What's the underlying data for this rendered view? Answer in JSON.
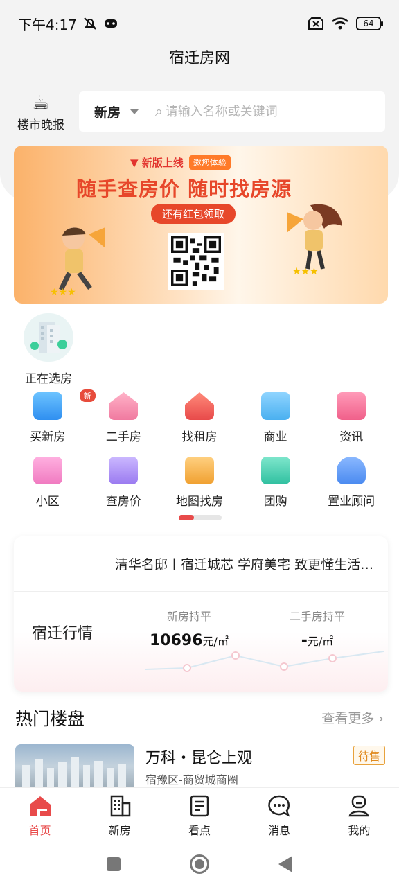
{
  "status_bar": {
    "time": "下午4:17",
    "battery": "64"
  },
  "header": {
    "title": "宿迁房网"
  },
  "evening_report": {
    "label": "楼市晚报",
    "icon": "coffee-cup-icon"
  },
  "search": {
    "type_selected": "新房",
    "placeholder": "请输入名称或关键词"
  },
  "banner": {
    "tag_new": "新版上线",
    "tag_try": "邀您体验",
    "headline": "随手查房价 随时找房源",
    "pill": "还有红包领取"
  },
  "selecting": {
    "label": "正在选房"
  },
  "categories": [
    {
      "label": "买新房",
      "badge": "新",
      "icon": "new-house-icon",
      "color": "#4a9cf0"
    },
    {
      "label": "二手房",
      "icon": "second-hand-house-icon",
      "color": "#f07aa0"
    },
    {
      "label": "找租房",
      "icon": "rent-house-icon",
      "color": "#e84a4a"
    },
    {
      "label": "商业",
      "icon": "commercial-building-icon",
      "color": "#4ab0f0"
    },
    {
      "label": "资讯",
      "icon": "news-icon",
      "color": "#f0608a"
    },
    {
      "label": "小区",
      "icon": "community-icon",
      "color": "#f07ac0"
    },
    {
      "label": "查房价",
      "icon": "price-check-icon",
      "color": "#9a7af0"
    },
    {
      "label": "地图找房",
      "icon": "map-search-icon",
      "color": "#f0a030"
    },
    {
      "label": "团购",
      "icon": "group-buy-icon",
      "color": "#30c0a0"
    },
    {
      "label": "置业顾问",
      "icon": "advisor-icon",
      "color": "#4a8af0"
    }
  ],
  "market": {
    "news": "清华名邸丨宿迁城芯 学府美宅 致更懂生活的你",
    "title": "宿迁行情",
    "new_house_label": "新房持平",
    "new_house_value": "10696",
    "unit": "元/㎡",
    "second_house_label": "二手房持平",
    "second_house_value": "-"
  },
  "hot": {
    "title": "热门楼盘",
    "more": "查看更多",
    "listing": {
      "name": "万科・昆仑上观",
      "area": "宿豫区-商贸城商圈",
      "status": "待售"
    }
  },
  "tabs": [
    {
      "label": "首页",
      "icon": "home-icon",
      "active": true
    },
    {
      "label": "新房",
      "icon": "building-icon"
    },
    {
      "label": "看点",
      "icon": "article-icon"
    },
    {
      "label": "消息",
      "icon": "message-icon"
    },
    {
      "label": "我的",
      "icon": "profile-icon"
    }
  ],
  "colors": {
    "accent": "#e84a4a",
    "status_tag": "#e08a1e"
  }
}
